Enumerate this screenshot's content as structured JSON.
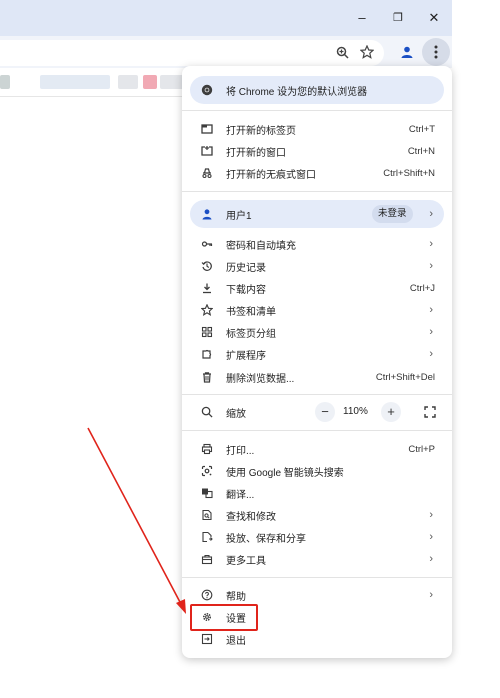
{
  "window": {
    "minimize_glyph": "–",
    "restore_glyph": "❐",
    "close_glyph": "✕"
  },
  "toolbar": {
    "icons": [
      "zoom-icon",
      "star-icon",
      "profile-icon",
      "kebab-menu-icon"
    ]
  },
  "colors": {
    "accent": "#1a4fc4",
    "banner_bg": "#e4ebf9",
    "highlight": "#e0241b"
  },
  "menu": {
    "default_banner": "将 Chrome 设为您的默认浏览器",
    "new_tab": {
      "label": "打开新的标签页",
      "shortcut": "Ctrl+T"
    },
    "new_window": {
      "label": "打开新的窗口",
      "shortcut": "Ctrl+N"
    },
    "incognito": {
      "label": "打开新的无痕式窗口",
      "shortcut": "Ctrl+Shift+N"
    },
    "user": {
      "label": "用户1",
      "status": "未登录"
    },
    "passwords": {
      "label": "密码和自动填充"
    },
    "history": {
      "label": "历史记录"
    },
    "downloads": {
      "label": "下载内容",
      "shortcut": "Ctrl+J"
    },
    "bookmarks": {
      "label": "书签和清单"
    },
    "tab_groups": {
      "label": "标签页分组"
    },
    "extensions": {
      "label": "扩展程序"
    },
    "clear_data": {
      "label": "删除浏览数据...",
      "shortcut": "Ctrl+Shift+Del"
    },
    "zoom": {
      "label": "缩放",
      "minus": "−",
      "value": "110%",
      "plus": "+"
    },
    "print": {
      "label": "打印...",
      "shortcut": "Ctrl+P"
    },
    "lens": {
      "label": "使用 Google 智能镜头搜索"
    },
    "translate": {
      "label": "翻译..."
    },
    "find_edit": {
      "label": "查找和修改"
    },
    "cast_save_share": {
      "label": "投放、保存和分享"
    },
    "more_tools": {
      "label": "更多工具"
    },
    "help": {
      "label": "帮助"
    },
    "settings": {
      "label": "设置"
    },
    "exit": {
      "label": "退出"
    },
    "chevron": "›"
  }
}
